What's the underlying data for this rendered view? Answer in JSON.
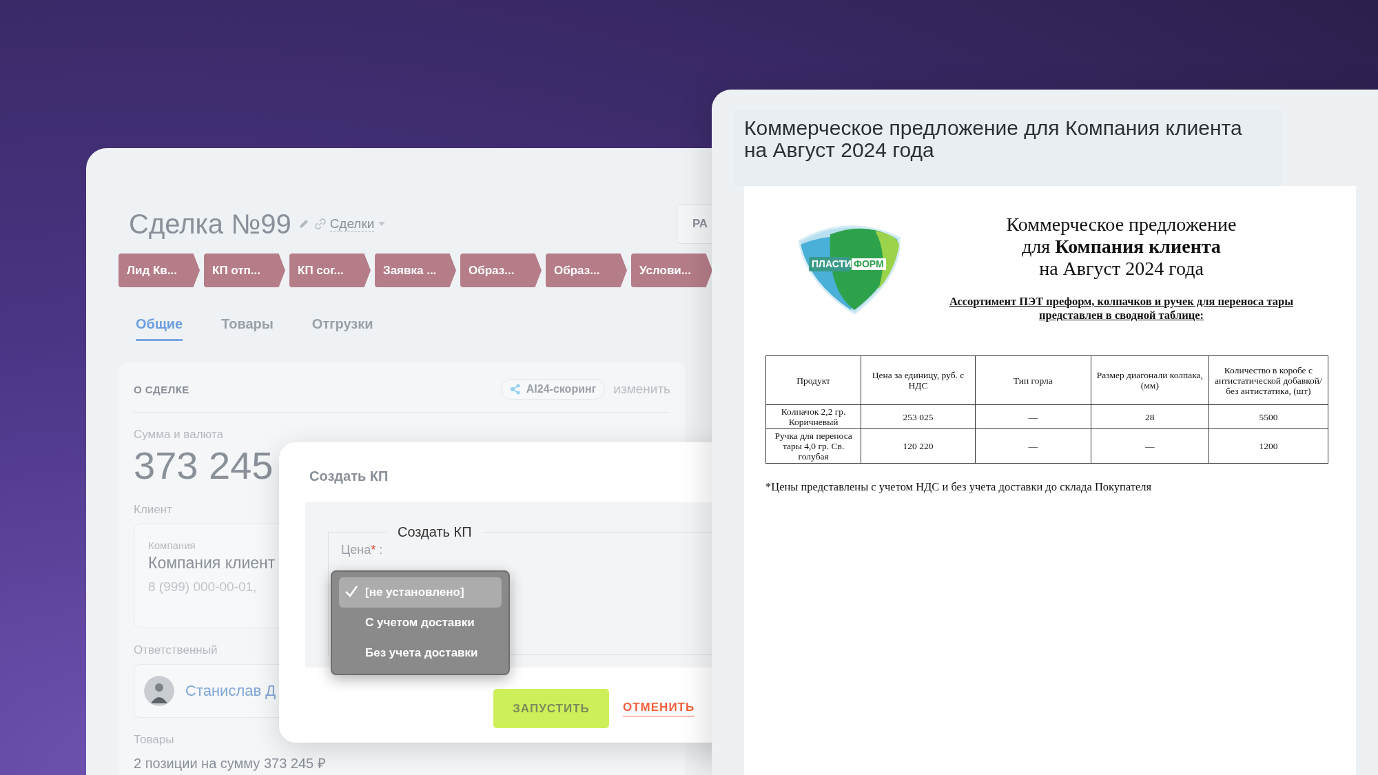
{
  "deal": {
    "title": "Сделка №99",
    "pipeline": "Сделки",
    "action_button": "РА",
    "stages": [
      {
        "label": "Лид Кв..."
      },
      {
        "label": "КП отп..."
      },
      {
        "label": "КП сог..."
      },
      {
        "label": "Заявка ..."
      },
      {
        "label": "Образ..."
      },
      {
        "label": "Образ..."
      },
      {
        "label": "Услови..."
      }
    ],
    "tabs": [
      {
        "label": "Общие",
        "selected": true
      },
      {
        "label": "Товары",
        "selected": false
      },
      {
        "label": "Отгрузки",
        "selected": false
      }
    ],
    "section": {
      "title": "О СДЕЛКЕ",
      "badge": "AI24-скоринг",
      "edit_link": "изменить"
    },
    "amount_label": "Сумма и валюта",
    "amount": "373 245",
    "client_label": "Клиент",
    "client": {
      "caption": "Компания",
      "name": "Компания клиент",
      "phone": "8 (999) 000-00-01,"
    },
    "responsible_label": "Ответственный",
    "responsible_name": "Станислав Д",
    "products_label": "Товары",
    "products_summary": "2 позиции на сумму 373 245 ₽"
  },
  "modal": {
    "title": "Создать КП",
    "group_title": "Создать КП",
    "field_label": "Цена",
    "required_mark": "*",
    "label_suffix": ":",
    "options": [
      {
        "label": "[не установлено]",
        "selected": true
      },
      {
        "label": "С учетом доставки",
        "selected": false
      },
      {
        "label": "Без учета доставки",
        "selected": false
      }
    ],
    "run_button": "ЗАПУСТИТЬ",
    "cancel_button": "ОТМЕНИТЬ"
  },
  "document": {
    "title": "Коммерческое предложение для Компания клиента на Август 2024 года",
    "logo_text": [
      "ПЛАСТИ",
      "ФОРМ"
    ],
    "heading": [
      "Коммерческое предложение",
      "для **Компания клиента**",
      "на Август 2024 года"
    ],
    "subtitle": "Ассортимент ПЭТ преформ, колпачков и ручек для переноса тары представлен в сводной таблице:",
    "table": {
      "columns": [
        "Продукт",
        "Цена за единицу, руб. с НДС",
        "Тип горла",
        "Размер диагонали колпака, (мм)",
        "Количество в коробе с антистатической добавкой/без антистатика, (шт)"
      ],
      "rows": [
        [
          "Колпачок 2,2 гр. Коричневый",
          "253 025",
          "—",
          "28",
          "5500"
        ],
        [
          "Ручка для переноса тары 4,0 гр. Св. голубая",
          "120 220",
          "—",
          "—",
          "1200"
        ]
      ]
    },
    "footnote": "*Цены представлены с учетом НДС и без учета доставки до склада Покупателя"
  }
}
